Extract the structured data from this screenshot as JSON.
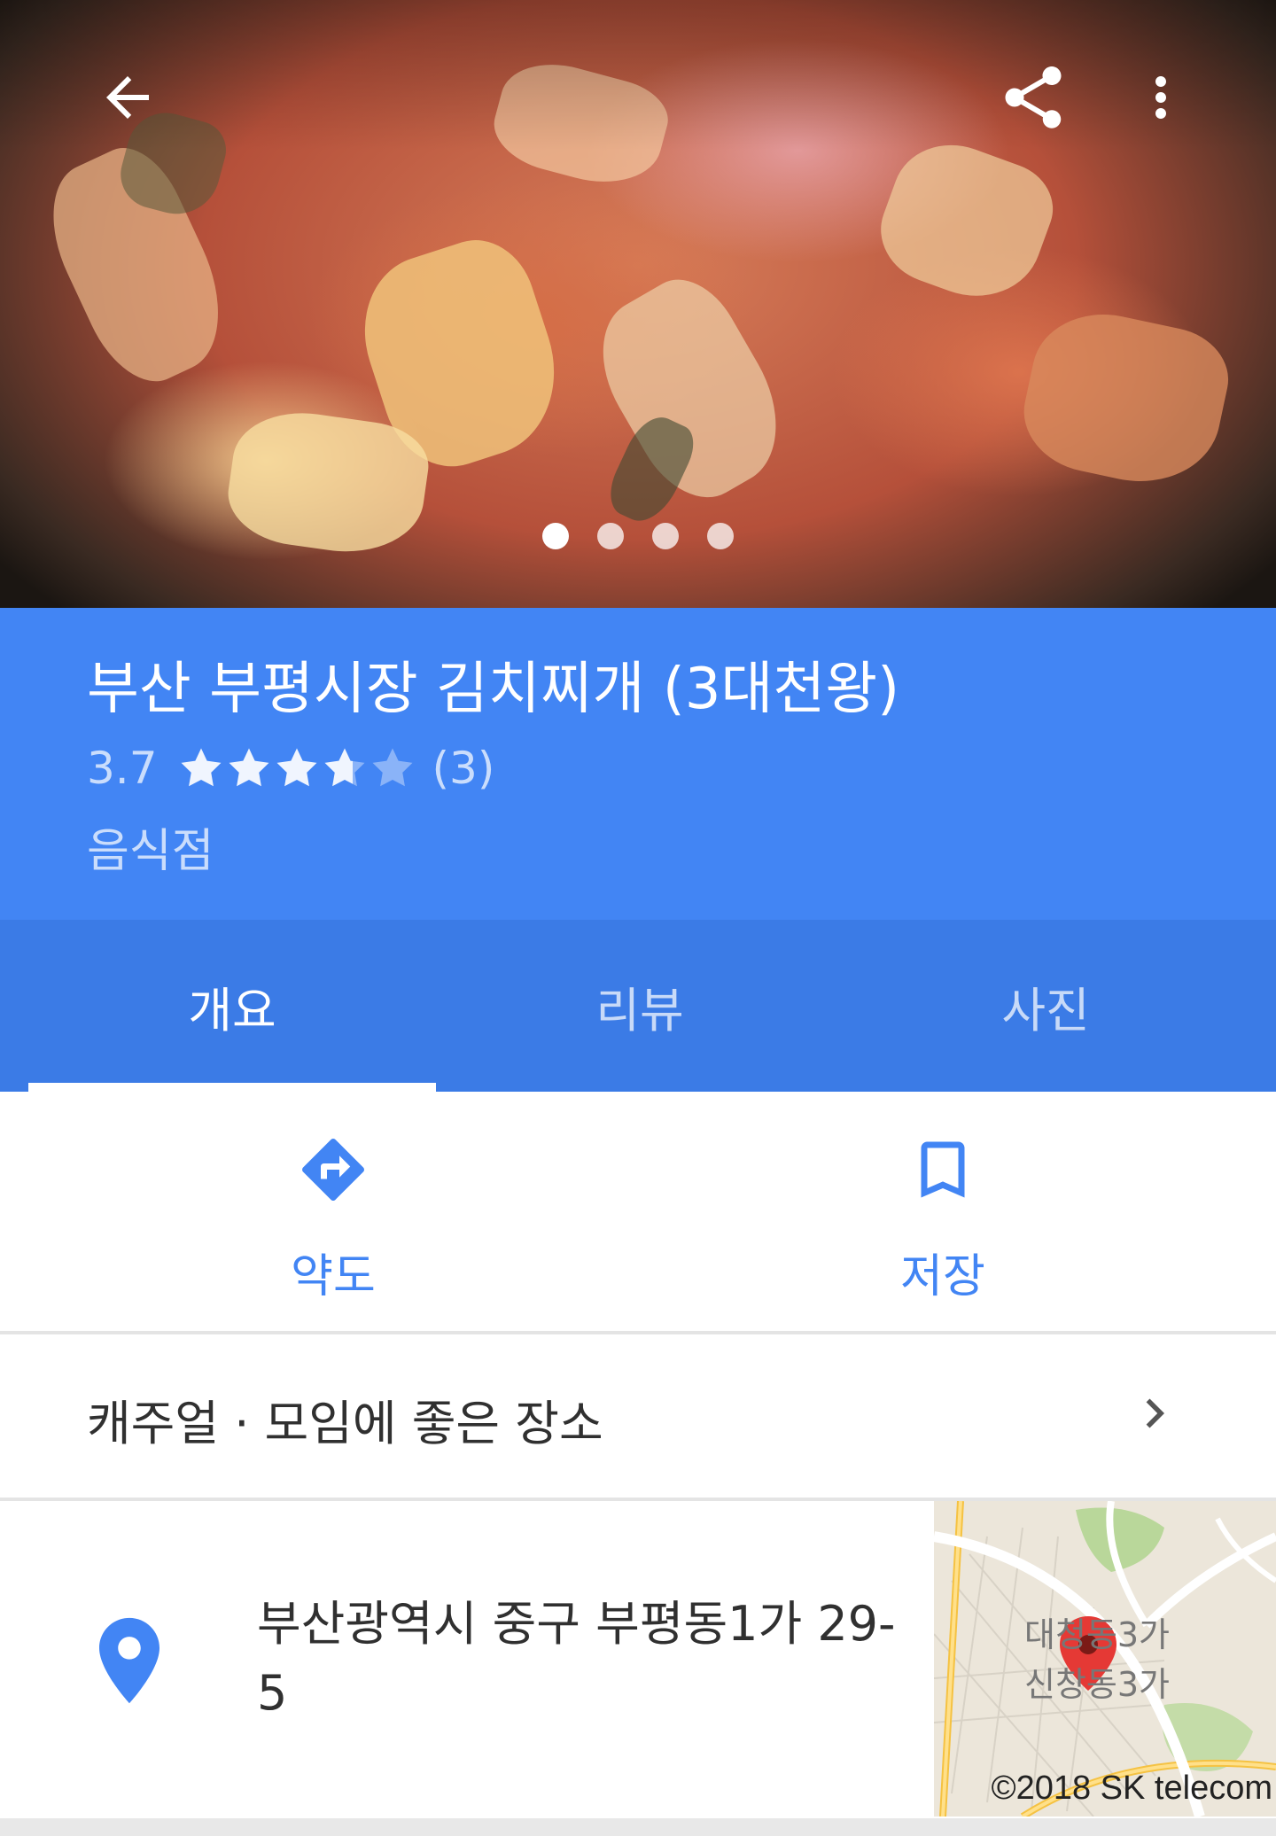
{
  "top_bar": {
    "back_icon": "arrow-back-icon",
    "share_icon": "share-icon",
    "more_icon": "more-vert-icon"
  },
  "photo_carousel": {
    "total": 4,
    "active_index": 0
  },
  "place": {
    "title": "부산 부평시장 김치찌개 (3대천왕)",
    "rating": "3.7",
    "rating_value": 3.7,
    "rating_max": 5,
    "review_count": "(3)",
    "category": "음식점"
  },
  "tabs": [
    {
      "label": "개요",
      "active": true
    },
    {
      "label": "리뷰",
      "active": false
    },
    {
      "label": "사진",
      "active": false
    }
  ],
  "actions": {
    "directions": {
      "label": "약도",
      "icon": "directions-icon"
    },
    "save": {
      "label": "저장",
      "icon": "bookmark-icon"
    }
  },
  "highlights": {
    "text": "캐주얼 · 모임에 좋은 장소",
    "icon": "chevron-right-icon"
  },
  "address": {
    "icon": "location-pin-icon",
    "line1": "부산광역시 중구 부평동1가 29-",
    "line2": "5"
  },
  "map": {
    "label1": "대청동3가",
    "label2": "신창동3가",
    "copyright": "©2018 SK telecom"
  },
  "colors": {
    "header_blue": "#4285f4",
    "tab_blue": "#3b7be6",
    "accent": "#4285f4",
    "map_pin": "#e53935"
  }
}
